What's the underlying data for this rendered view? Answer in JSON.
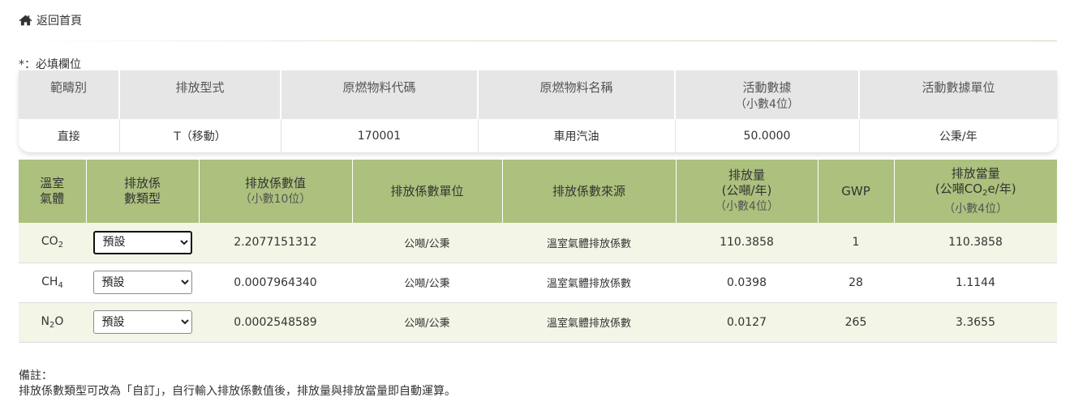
{
  "nav": {
    "back_label": "返回首頁",
    "icon": "home-icon"
  },
  "form": {
    "required_note": "*：必填欄位"
  },
  "activity_table": {
    "headers": [
      {
        "main": "範疇別",
        "sub": ""
      },
      {
        "main": "排放型式",
        "sub": ""
      },
      {
        "main": "原燃物料代碼",
        "sub": ""
      },
      {
        "main": "原燃物料名稱",
        "sub": ""
      },
      {
        "main": "活動數據",
        "sub": "（小數4位）"
      },
      {
        "main": "活動數據單位",
        "sub": ""
      }
    ],
    "row": {
      "scope": "直接",
      "emission_type": "T（移動）",
      "material_code": "170001",
      "material_name": "車用汽油",
      "activity_data": "50.0000",
      "activity_unit": "公秉/年"
    }
  },
  "emission_table": {
    "headers": {
      "gas_l1": "溫室",
      "gas_l2": "氣體",
      "factor_type_l1": "排放係",
      "factor_type_l2": "數類型",
      "factor_value": "排放係數值",
      "factor_value_sub": "（小數10位）",
      "factor_unit": "排放係數單位",
      "factor_source": "排放係數來源",
      "emission": "排放量",
      "emission_unit": "(公噸/年)",
      "emission_sub": "（小數4位）",
      "gwp": "GWP",
      "equivalent": "排放當量",
      "equivalent_unit_pre": "(公噸CO",
      "equivalent_unit_sub": "2",
      "equivalent_unit_post": "e/年)",
      "equivalent_sub": "（小數4位）"
    },
    "rows": [
      {
        "gas_base": "CO",
        "gas_sub": "2",
        "gas_tail": "",
        "factor_type": "預設",
        "factor_value": "2.2077151312",
        "factor_unit": "公噸/公秉",
        "factor_source": "溫室氣體排放係數",
        "emission": "110.3858",
        "gwp": "1",
        "equivalent": "110.3858"
      },
      {
        "gas_base": "CH",
        "gas_sub": "4",
        "gas_tail": "",
        "factor_type": "預設",
        "factor_value": "0.0007964340",
        "factor_unit": "公噸/公秉",
        "factor_source": "溫室氣體排放係數",
        "emission": "0.0398",
        "gwp": "28",
        "equivalent": "1.1144"
      },
      {
        "gas_base": "N",
        "gas_sub": "2",
        "gas_tail": "O",
        "factor_type": "預設",
        "factor_value": "0.0002548589",
        "factor_unit": "公噸/公秉",
        "factor_source": "溫室氣體排放係數",
        "emission": "0.0127",
        "gwp": "265",
        "equivalent": "3.3655"
      }
    ]
  },
  "remarks": {
    "title": "備註：",
    "text": "排放係數類型可改為「自訂」，自行輸入排放係數值後，排放量與排放當量即自動運算。"
  },
  "colors": {
    "header_green": "#acc17d",
    "header_gray": "#e6e6e6",
    "row_tint": "#f3f5e6"
  }
}
